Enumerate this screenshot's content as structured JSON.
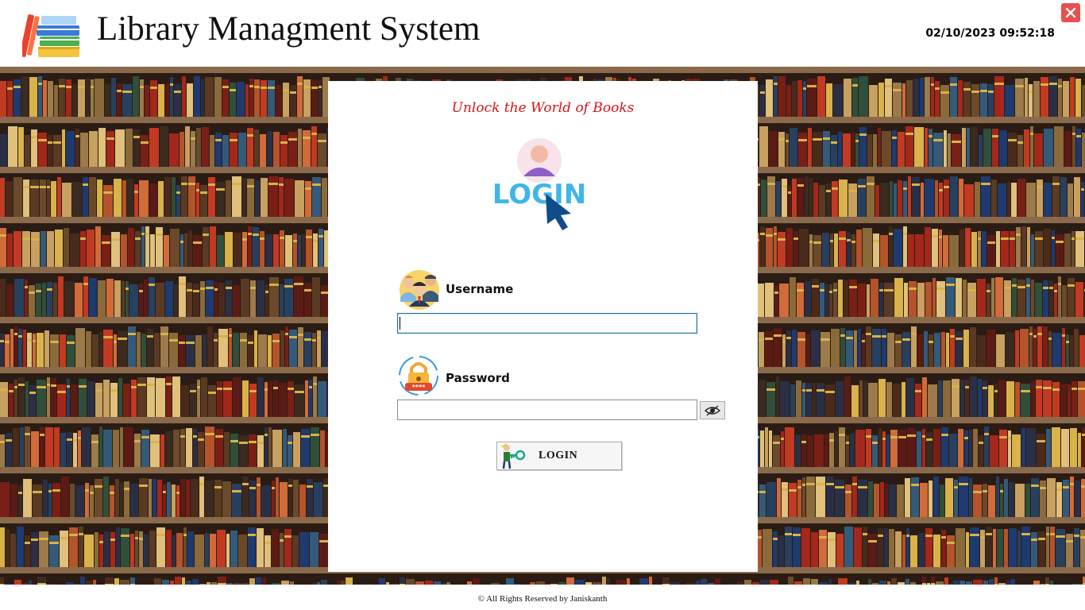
{
  "app": {
    "title": "Library Managment System",
    "datetime": "02/10/2023 09:52:18",
    "close_label": "✕"
  },
  "login": {
    "tagline": "Unlock the World of Books",
    "graphic_text": "LOGIN",
    "username_label": "Username",
    "username_value": "",
    "password_label": "Password",
    "password_value": "",
    "button_label": "LOGIN"
  },
  "icons": {
    "app_logo": "books-stack-icon",
    "close": "close-icon",
    "login_graphic": "login-cursor-icon",
    "username": "users-group-icon",
    "password": "padlock-icon",
    "toggle_password": "eye-icon",
    "login_button": "key-icon"
  },
  "colors": {
    "tagline": "#d31515",
    "close_button": "#e85050",
    "login_graphic_text": "#3fb6e8",
    "login_cursor": "#0f4c8a",
    "username_focus_border": "#1f6fa6"
  },
  "footer": {
    "text": "© All Rights Reserved by Janiskanth"
  }
}
